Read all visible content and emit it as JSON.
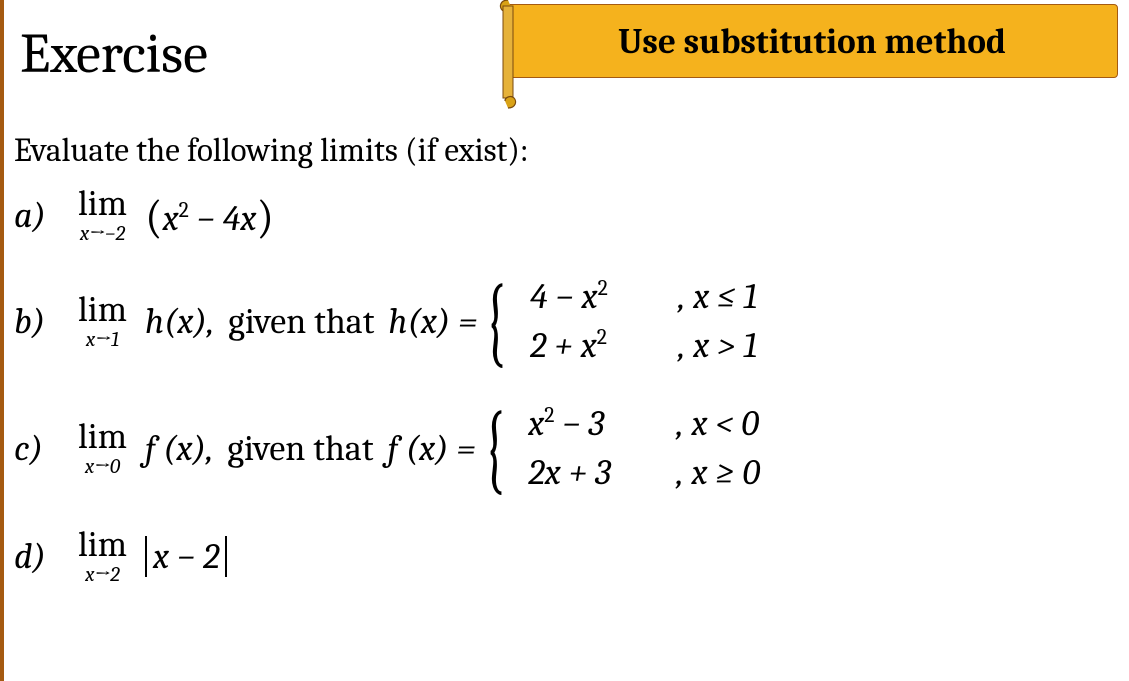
{
  "header": {
    "title": "Exercise",
    "banner": "Use substitution method"
  },
  "intro": "Evaluate the following limits (if exist):",
  "problems": {
    "a": {
      "label": "a)",
      "lim_word": "lim",
      "lim_sub": "x→−2",
      "expr_open": "(",
      "expr_body": "x² − 4x",
      "expr_close": ")"
    },
    "b": {
      "label": "b)",
      "lim_word": "lim",
      "lim_sub": "x→1",
      "expr": "h(x),",
      "given_text": "given that",
      "fn_def": "h(x) =",
      "case1_lhs": "4 − x²",
      "case1_cond": ",   x ≤ 1",
      "case2_lhs": "2 + x²",
      "case2_cond": ",   x > 1"
    },
    "c": {
      "label": "c)",
      "lim_word": "lim",
      "lim_sub": "x→0",
      "expr": "f (x),",
      "given_text": "given that",
      "fn_def": "f (x) =",
      "case1_lhs": "x² − 3",
      "case1_cond": ",   x < 0",
      "case2_lhs": "2x + 3",
      "case2_cond": ",   x ≥ 0"
    },
    "d": {
      "label": "d)",
      "lim_word": "lim",
      "lim_sub": "x→2",
      "abs_body": "x − 2"
    }
  }
}
